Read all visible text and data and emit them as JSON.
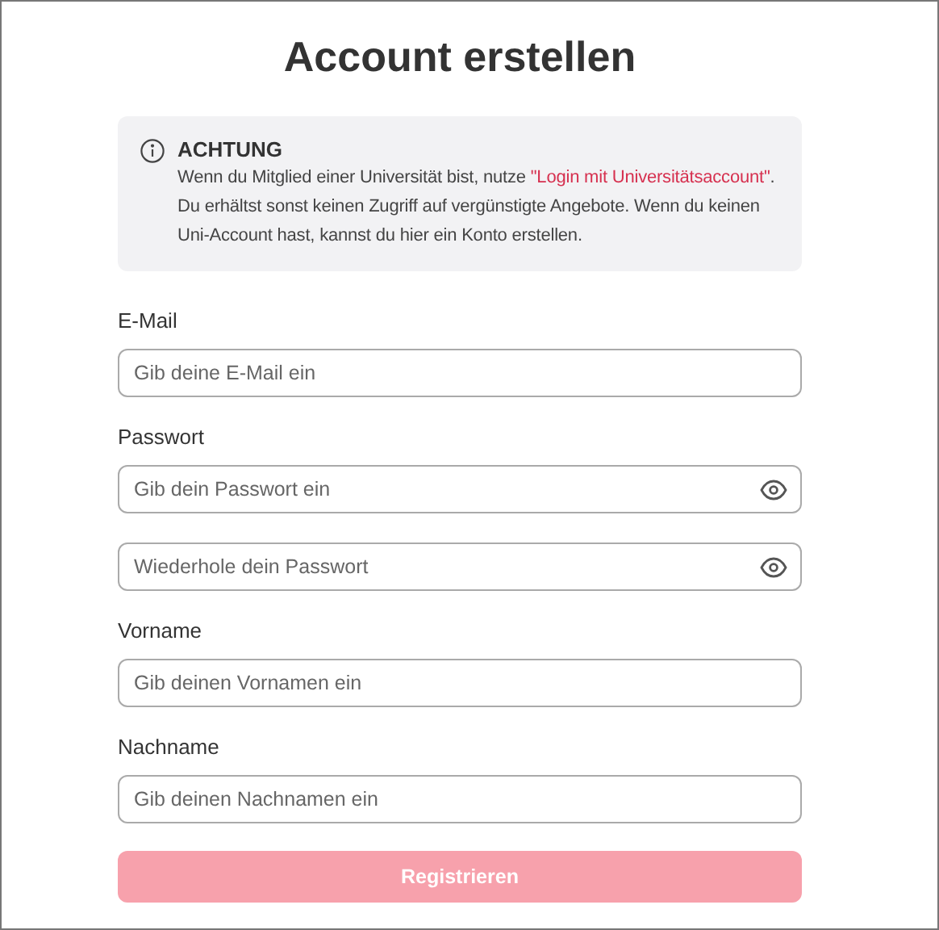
{
  "title": "Account erstellen",
  "notice": {
    "heading": "ACHTUNG",
    "text": "Wenn du Mitglied einer Universität bist, nutze ",
    "link": "\"Login mit Universitätsaccount\"",
    "text_after": ". Du erhältst sonst keinen Zugriff auf vergünstigte Angebote. Wenn du keinen Uni-Account hast, kannst du hier ein Konto erstellen."
  },
  "groups": [
    {
      "label": "E-Mail",
      "fields": [
        {
          "placeholder": "Gib deine E-Mail ein",
          "reveal_toggle": false
        }
      ]
    },
    {
      "label": "Passwort",
      "fields": [
        {
          "placeholder": "Gib dein Passwort ein",
          "reveal_toggle": true
        },
        {
          "placeholder": "Wiederhole dein Passwort",
          "reveal_toggle": true
        }
      ]
    },
    {
      "label": "Vorname",
      "fields": [
        {
          "placeholder": "Gib deinen Vornamen ein",
          "reveal_toggle": false
        }
      ]
    },
    {
      "label": "Nachname",
      "fields": [
        {
          "placeholder": "Gib deinen Nachnamen ein",
          "reveal_toggle": false
        }
      ]
    }
  ],
  "submit": {
    "label": "Registrieren",
    "disabled": true
  }
}
